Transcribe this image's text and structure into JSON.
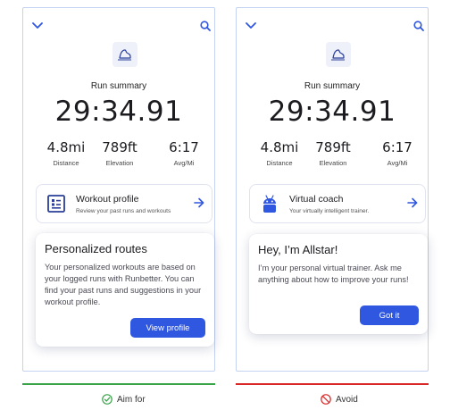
{
  "colors": {
    "accent": "#2f57e0",
    "aim_for": "#39a34a",
    "avoid": "#d92626",
    "phone_border": "#c6d2f2"
  },
  "left": {
    "summary_title": "Run summary",
    "time": "29:34.91",
    "stats": [
      {
        "value": "4.8mi",
        "label": "Distance"
      },
      {
        "value": "789ft",
        "label": "Elevation"
      },
      {
        "value": "6:17",
        "label": "Avg/Mi"
      }
    ],
    "tile": {
      "icon": "profile-list-icon",
      "title": "Workout profile",
      "subtitle": "Review your past runs and workouts"
    },
    "card": {
      "title": "Personalized routes",
      "body": "Your personalized workouts are based on your logged runs with Runbetter. You can find your past runs and suggestions in your workout profile.",
      "button": "View profile"
    }
  },
  "right": {
    "summary_title": "Run summary",
    "time": "29:34.91",
    "stats": [
      {
        "value": "4.8mi",
        "label": "Distance"
      },
      {
        "value": "789ft",
        "label": "Elevation"
      },
      {
        "value": "6:17",
        "label": "Avg/Mi"
      }
    ],
    "tile": {
      "icon": "android-robot-icon",
      "title": "Virtual coach",
      "subtitle": "Your virtually intelligent trainer."
    },
    "card": {
      "title": "Hey, I’m Allstar!",
      "body": "I’m your personal virtual trainer. Ask me anything about how to improve your runs!",
      "button": "Got it"
    }
  },
  "verdicts": {
    "left": {
      "icon": "check-circle-icon",
      "label": "Aim for"
    },
    "right": {
      "icon": "prohibited-icon",
      "label": "Avoid"
    }
  }
}
